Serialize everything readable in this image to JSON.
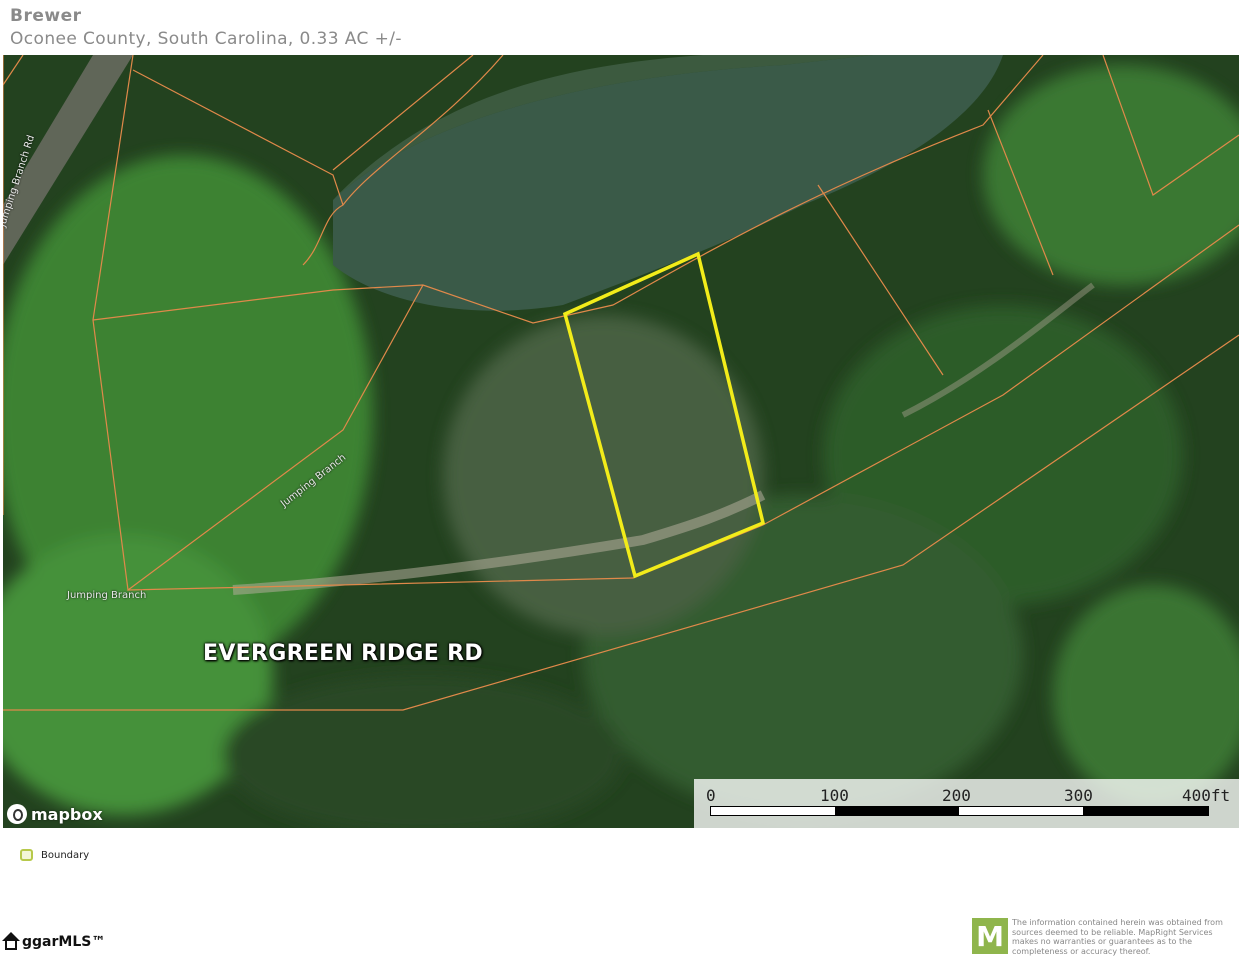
{
  "header": {
    "title": "Brewer",
    "subtitle": "Oconee County, South Carolina, 0.33 AC +/-"
  },
  "map": {
    "road_label": "EVERGREEN RIDGE RD",
    "street_labels": [
      "Jumping Branch Rd",
      "Jumping Branch",
      "Jumping Branch"
    ],
    "provider": "mapbox",
    "scale": {
      "labels": [
        "0",
        "100",
        "200",
        "300",
        "400ft"
      ]
    },
    "colors": {
      "boundary": "#f2ec1a",
      "parcel_lines": "#e0894a",
      "water": "#3a5a4a"
    }
  },
  "legend": {
    "label": "Boundary"
  },
  "footer": {
    "mls_logo": "ggarMLS™",
    "badge_letter": "M",
    "disclaimer": "The information contained herein was obtained from sources deemed to be reliable. MapRight Services makes no warranties or guarantees as to the completeness or accuracy thereof."
  }
}
